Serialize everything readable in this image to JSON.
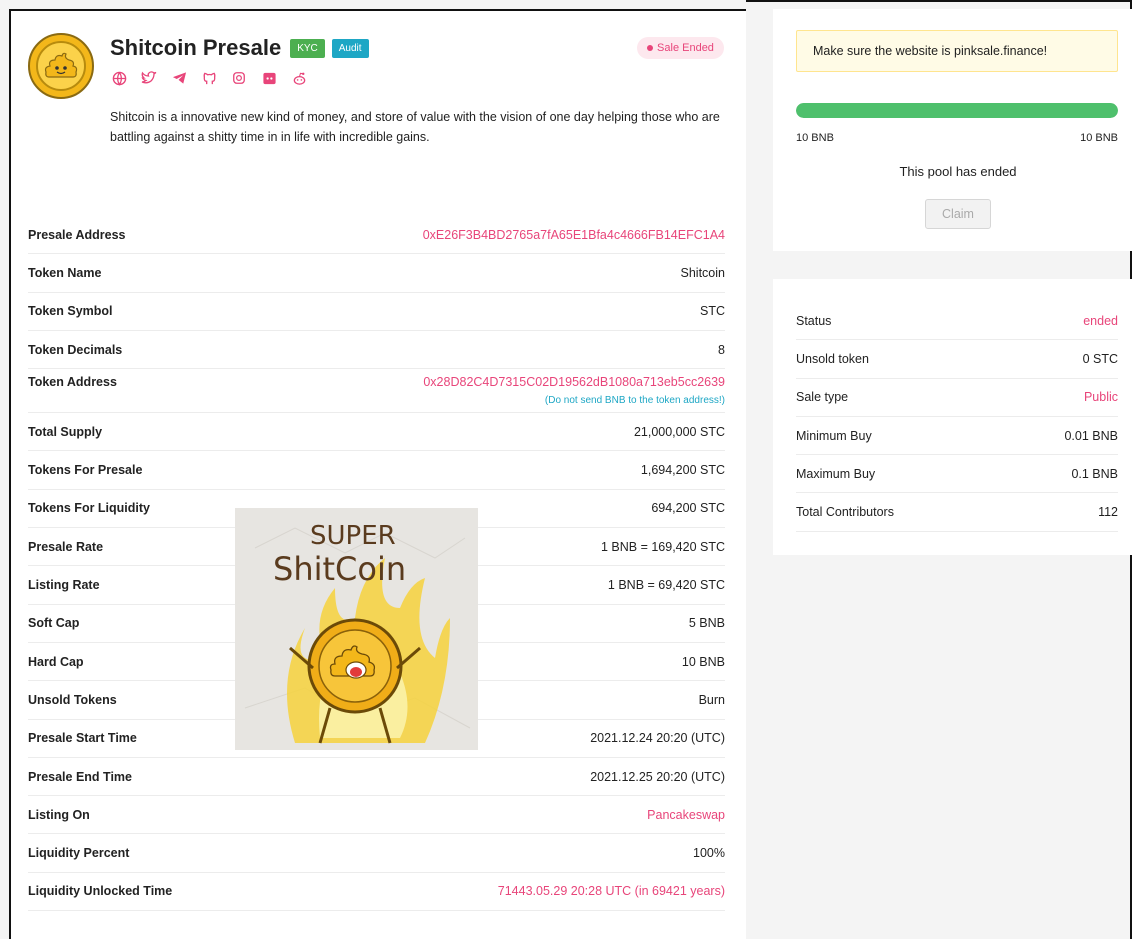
{
  "header": {
    "title": "Shitcoin Presale",
    "badges": {
      "kyc": "KYC",
      "audit": "Audit"
    },
    "sale_status": "Sale Ended",
    "description": "Shitcoin is a innovative new kind of money, and store of value with the vision of one day helping those who are battling against a shitty time in in life with incredible gains.",
    "socials": [
      "globe-icon",
      "twitter-icon",
      "telegram-icon",
      "github-icon",
      "instagram-icon",
      "discord-icon",
      "reddit-icon"
    ]
  },
  "details": [
    {
      "label": "Presale Address",
      "value": "0xE26F3B4BD2765a7fA65E1Bfa4c4666FB14EFC1A4",
      "pink": true
    },
    {
      "label": "Token Name",
      "value": "Shitcoin"
    },
    {
      "label": "Token Symbol",
      "value": "STC"
    },
    {
      "label": "Token Decimals",
      "value": "8"
    },
    {
      "label": "Token Address",
      "value": "0x28D82C4D7315C02D19562dB1080a713eb5cc2639",
      "pink": true,
      "note": "(Do not send BNB to the token address!)"
    },
    {
      "label": "Total Supply",
      "value": "21,000,000 STC"
    },
    {
      "label": "Tokens For Presale",
      "value": "1,694,200 STC"
    },
    {
      "label": "Tokens For Liquidity",
      "value": "694,200 STC"
    },
    {
      "label": "Presale Rate",
      "value": "1 BNB = 169,420 STC"
    },
    {
      "label": "Listing Rate",
      "value": "1 BNB = 69,420 STC"
    },
    {
      "label": "Soft Cap",
      "value": "5 BNB"
    },
    {
      "label": "Hard Cap",
      "value": "10 BNB"
    },
    {
      "label": "Unsold Tokens",
      "value": "Burn"
    },
    {
      "label": "Presale Start Time",
      "value": "2021.12.24 20:20 (UTC)"
    },
    {
      "label": "Presale End Time",
      "value": "2021.12.25 20:20 (UTC)"
    },
    {
      "label": "Listing On",
      "value": "Pancakeswap",
      "pink": true
    },
    {
      "label": "Liquidity Percent",
      "value": "100%"
    },
    {
      "label": "Liquidity Unlocked Time",
      "value": "71443.05.29 20:28 UTC (in 69421 years)",
      "pink": true
    }
  ],
  "image": {
    "text_line1": "SUPER",
    "text_line2": "ShitCoin"
  },
  "pool": {
    "notice": "Make sure the website is pinksale.finance!",
    "progress_percent": 100,
    "raised": "10 BNB",
    "cap": "10 BNB",
    "ended_text": "This pool has ended",
    "claim_label": "Claim"
  },
  "stats": [
    {
      "label": "Status",
      "value": "ended",
      "pink": true
    },
    {
      "label": "Unsold token",
      "value": "0 STC"
    },
    {
      "label": "Sale type",
      "value": "Public",
      "pink": true
    },
    {
      "label": "Minimum Buy",
      "value": "0.01 BNB"
    },
    {
      "label": "Maximum Buy",
      "value": "0.1 BNB"
    },
    {
      "label": "Total Contributors",
      "value": "112"
    }
  ],
  "colors": {
    "accent": "#e8457a",
    "progress": "#4ec06c",
    "kyc": "#4caf50",
    "audit": "#1ea7c5"
  }
}
